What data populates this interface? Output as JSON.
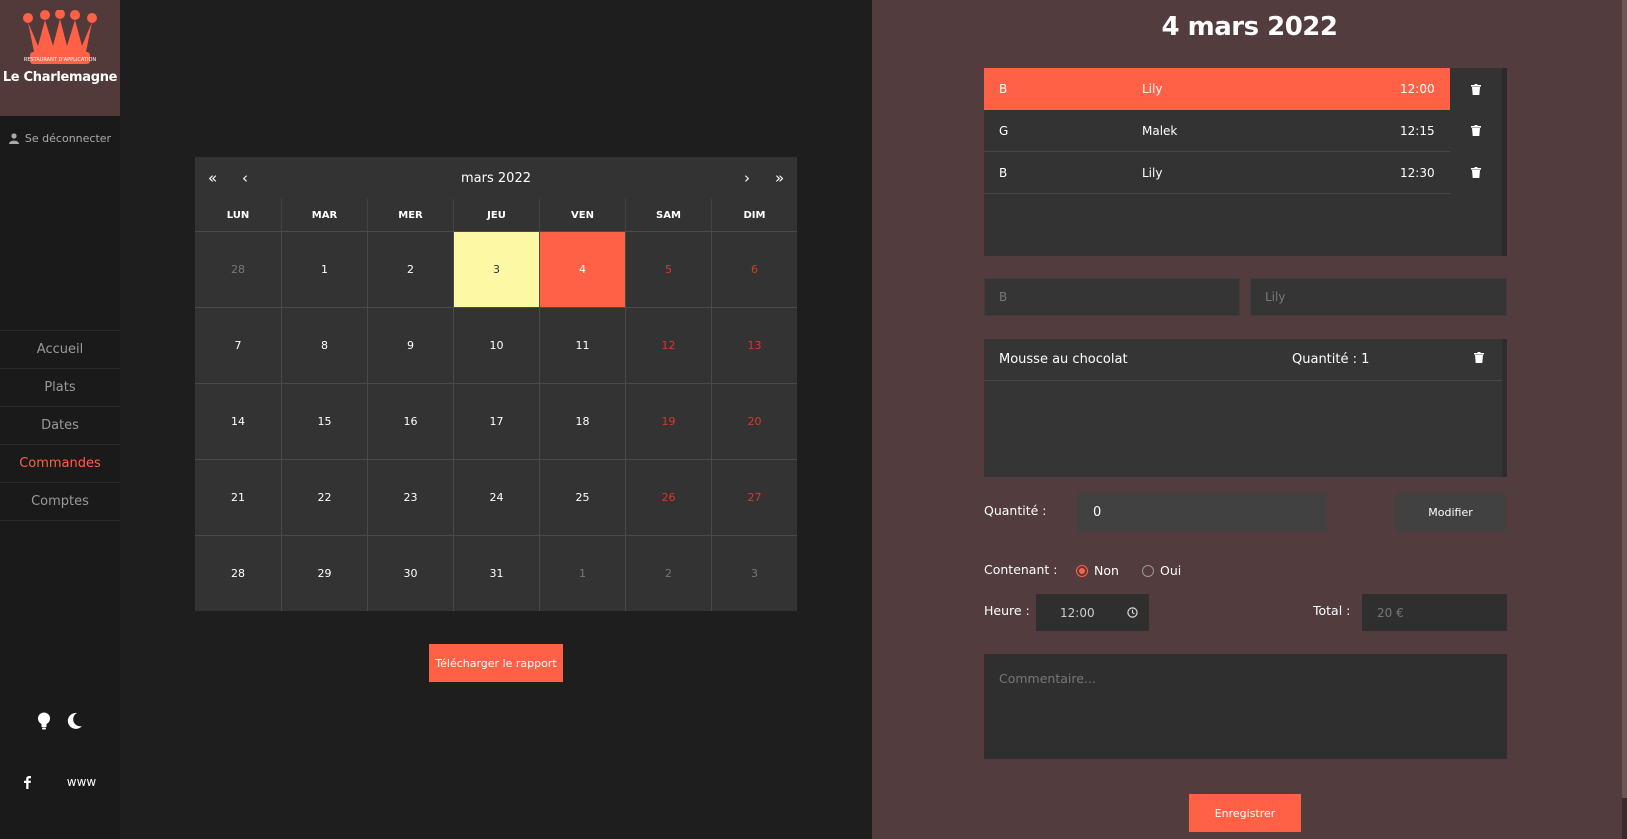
{
  "brand": {
    "badge": "RESTAURANT D'APPLICATION",
    "name": "Le Charlemagne"
  },
  "sidebar": {
    "logout": "Se déconnecter",
    "items": [
      {
        "label": "Accueil",
        "active": false
      },
      {
        "label": "Plats",
        "active": false
      },
      {
        "label": "Dates",
        "active": false
      },
      {
        "label": "Commandes",
        "active": true
      },
      {
        "label": "Comptes",
        "active": false
      }
    ],
    "social_www": "www"
  },
  "calendar": {
    "title": "mars 2022",
    "prev_year": "«",
    "prev_month": "‹",
    "next_month": "›",
    "next_year": "»",
    "weekdays": [
      "LUN",
      "MAR",
      "MER",
      "JEU",
      "VEN",
      "SAM",
      "DIM"
    ],
    "days": [
      {
        "d": "28",
        "state": "muted"
      },
      {
        "d": "1"
      },
      {
        "d": "2"
      },
      {
        "d": "3",
        "state": "today"
      },
      {
        "d": "4",
        "state": "selected"
      },
      {
        "d": "5",
        "state": "weekend"
      },
      {
        "d": "6",
        "state": "weekend"
      },
      {
        "d": "7"
      },
      {
        "d": "8"
      },
      {
        "d": "9"
      },
      {
        "d": "10"
      },
      {
        "d": "11"
      },
      {
        "d": "12",
        "state": "weekend"
      },
      {
        "d": "13",
        "state": "weekend"
      },
      {
        "d": "14"
      },
      {
        "d": "15"
      },
      {
        "d": "16"
      },
      {
        "d": "17"
      },
      {
        "d": "18"
      },
      {
        "d": "19",
        "state": "weekend"
      },
      {
        "d": "20",
        "state": "weekend"
      },
      {
        "d": "21"
      },
      {
        "d": "22"
      },
      {
        "d": "23"
      },
      {
        "d": "24"
      },
      {
        "d": "25"
      },
      {
        "d": "26",
        "state": "weekend"
      },
      {
        "d": "27",
        "state": "weekend"
      },
      {
        "d": "28"
      },
      {
        "d": "29"
      },
      {
        "d": "30"
      },
      {
        "d": "31"
      },
      {
        "d": "1",
        "state": "muted"
      },
      {
        "d": "2",
        "state": "muted"
      },
      {
        "d": "3",
        "state": "muted"
      }
    ],
    "download_label": "Télécharger le rapport"
  },
  "panel": {
    "title": "4 mars 2022",
    "orders": [
      {
        "code": "B",
        "name": "Lily",
        "time": "12:00",
        "active": true
      },
      {
        "code": "G",
        "name": "Malek",
        "time": "12:15",
        "active": false
      },
      {
        "code": "B",
        "name": "Lily",
        "time": "12:30",
        "active": false
      }
    ],
    "code_field": "B",
    "name_field": "Lily",
    "items": [
      {
        "name": "Mousse au chocolat",
        "qty": "Quantité : 1"
      }
    ],
    "qty_label": "Quantité :",
    "qty_value": "0",
    "modify_label": "Modifier",
    "container_label": "Contenant :",
    "radio_non": "Non",
    "radio_oui": "Oui",
    "time_label": "Heure :",
    "time_value": "12:00",
    "total_label": "Total :",
    "total_value": "20 €",
    "comment_placeholder": "Commentaire...",
    "save_label": "Enregistrer"
  },
  "colors": {
    "accent": "#ff6147",
    "today": "#fcf8a4",
    "panel_bg": "#533c3d"
  }
}
